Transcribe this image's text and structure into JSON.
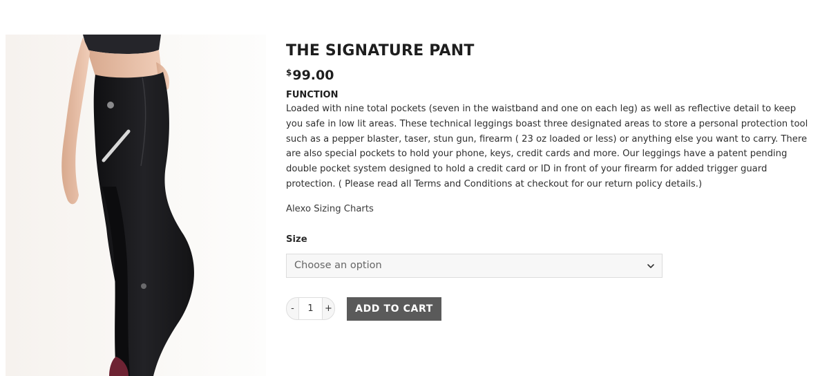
{
  "product": {
    "title": "THE SIGNATURE PANT",
    "price_currency": "$",
    "price_amount": "99.00",
    "function_heading": "FUNCTION",
    "description_lines": [
      "Loaded with nine total pockets (seven in the waistband and one on each leg) as well as reflective detail to keep",
      "you safe in low lit areas. These technical leggings boast three designated areas to store a personal protection tool",
      "such as a pepper blaster, taser, stun gun, firearm ( 23 oz loaded or less) or anything else you want to carry. There",
      "are also special pockets to hold your phone, keys, credit cards and more. Our leggings have a patent pending",
      "double pocket system designed to hold a credit card or ID in front of your firearm for added trigger guard",
      "protection. ( Please read all Terms and Conditions at checkout for our return policy details.)"
    ],
    "sizing_link": "Alexo Sizing Charts"
  },
  "options": {
    "size_label": "Size",
    "size_select_value": "Choose an option"
  },
  "cart": {
    "minus_label": "-",
    "quantity": "1",
    "plus_label": "+",
    "add_to_cart_label": "ADD TO CART"
  },
  "colors": {
    "button_bg": "#5a5a5a",
    "legging": "#1c1c1e",
    "skin": "#e8c1a8",
    "sports_bra": "#25252a",
    "shoe": "#6e2333"
  },
  "icons": {
    "select_chevron": "chevron-down-icon"
  }
}
